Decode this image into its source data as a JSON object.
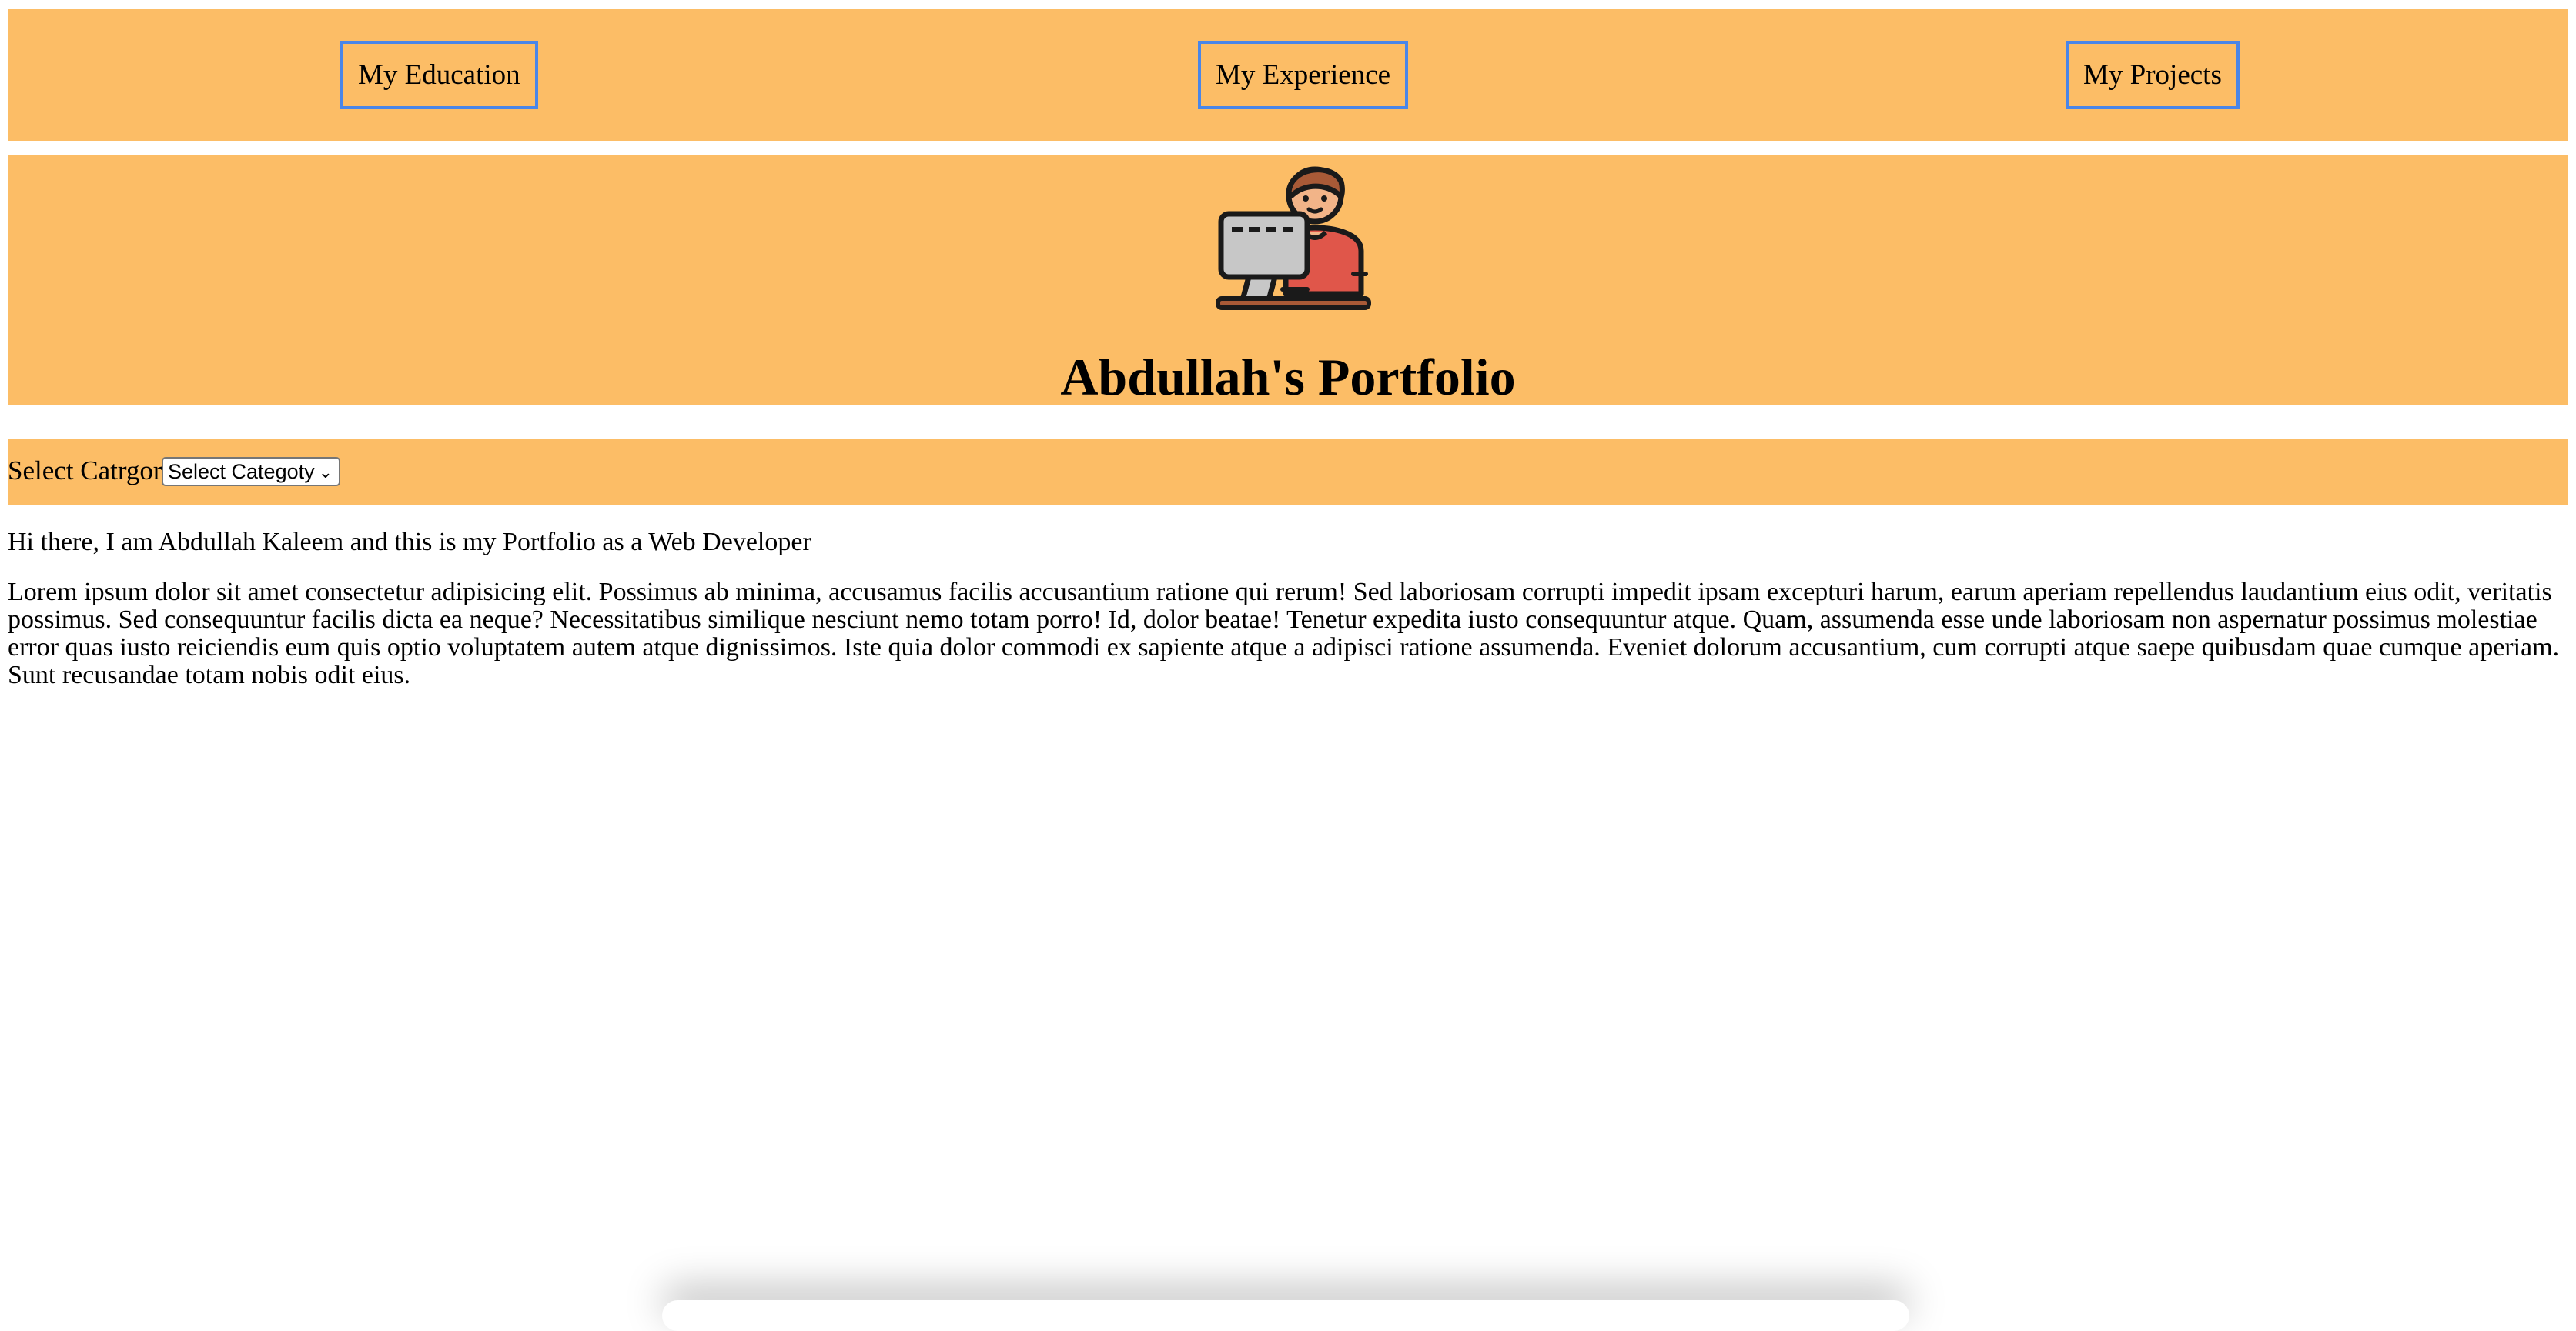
{
  "nav": {
    "items": [
      {
        "label": "My Education"
      },
      {
        "label": "My Experience"
      },
      {
        "label": "My Projects"
      }
    ]
  },
  "hero": {
    "icon": "developer-at-computer-icon",
    "title": "Abdullah's Portfolio"
  },
  "filter": {
    "label": "Select Catrgory",
    "selected": "Select Categoty"
  },
  "content": {
    "intro": "Hi there, I am Abdullah Kaleem and this is my Portfolio as a Web Developer",
    "body": "Lorem ipsum dolor sit amet consectetur adipisicing elit. Possimus ab minima, accusamus facilis accusantium ratione qui rerum! Sed laboriosam corrupti impedit ipsam excepturi harum, earum aperiam repellendus laudantium eius odit, veritatis possimus. Sed consequuntur facilis dicta ea neque? Necessitatibus similique nesciunt nemo totam porro! Id, dolor beatae! Tenetur expedita iusto consequuntur atque. Quam, assumenda esse unde laboriosam non aspernatur possimus molestiae error quas iusto reiciendis eum quis optio voluptatem autem atque dignissimos. Iste quia dolor commodi ex sapiente atque a adipisci ratione assumenda. Eveniet dolorum accusantium, cum corrupti atque saepe quibusdam quae cumque aperiam. Sunt recusandae totam nobis odit eius."
  },
  "colors": {
    "accent": "#fcbd66",
    "button_border": "#4a86e8"
  }
}
